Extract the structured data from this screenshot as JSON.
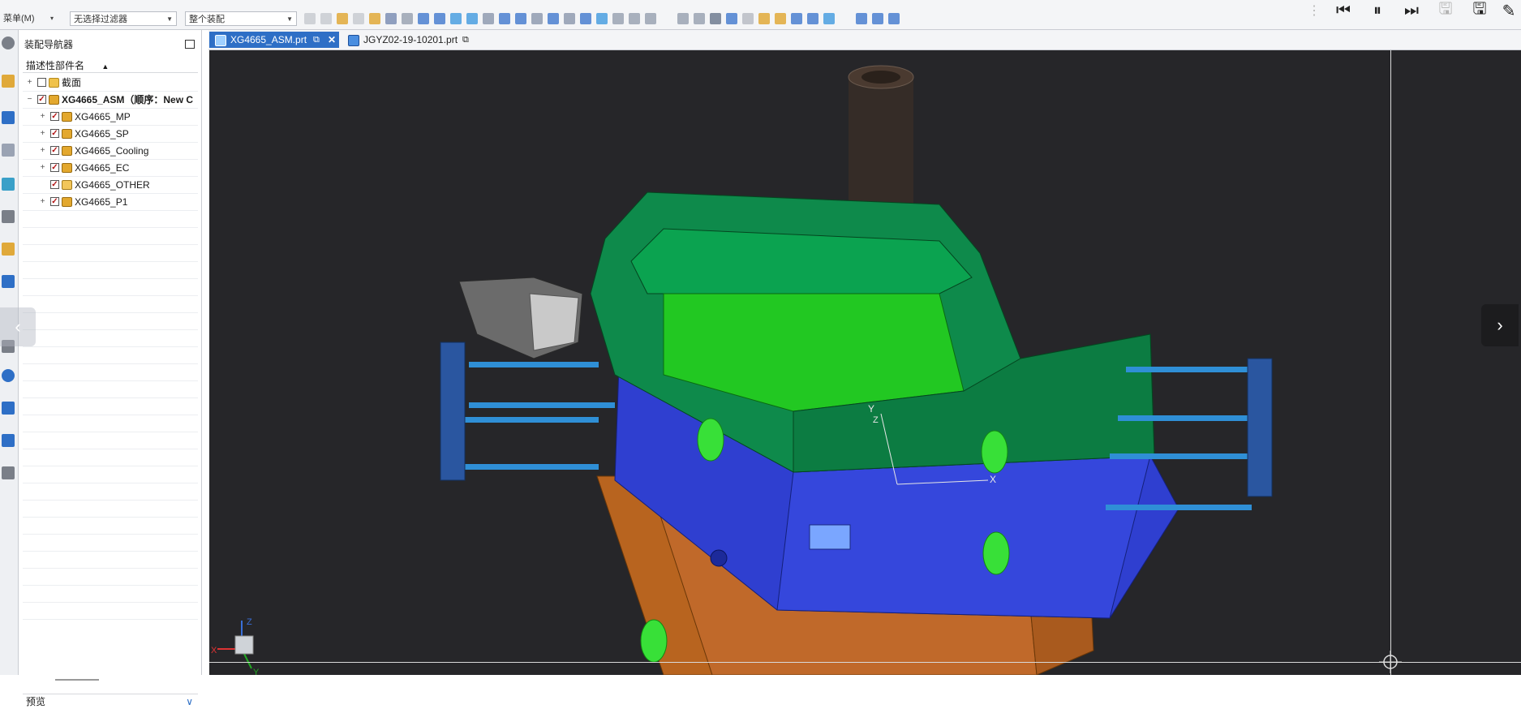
{
  "toolbar": {
    "menu_label": "菜单(M)",
    "filter_value": "无选择过滤器",
    "scope_value": "整个装配"
  },
  "media": {
    "controls": [
      "menu-icon",
      "skip-back-icon",
      "pause-icon",
      "skip-forward-icon",
      "save-icon",
      "save-as-icon",
      "edit-icon"
    ]
  },
  "navigator": {
    "title": "装配导航器",
    "column_header": "描述性部件名",
    "tree": [
      {
        "label": "截面",
        "checked": false,
        "expander": "+",
        "icon": "folder"
      },
      {
        "label": "XG4665_ASM（顺序：New C",
        "checked": true,
        "expander": "−",
        "icon": "assembly",
        "bold": true
      },
      {
        "label": "XG4665_MP",
        "checked": true,
        "expander": "+",
        "icon": "assembly"
      },
      {
        "label": "XG4665_SP",
        "checked": true,
        "expander": "+",
        "icon": "assembly"
      },
      {
        "label": "XG4665_Cooling",
        "checked": true,
        "expander": "+",
        "icon": "assembly"
      },
      {
        "label": "XG4665_EC",
        "checked": true,
        "expander": "+",
        "icon": "assembly"
      },
      {
        "label": "XG4665_OTHER",
        "checked": true,
        "expander": "",
        "icon": "part"
      },
      {
        "label": "XG4665_P1",
        "checked": true,
        "expander": "+",
        "icon": "assembly"
      }
    ],
    "preview_label": "预览"
  },
  "tabs": [
    {
      "label": "XG4665_ASM.prt",
      "active": true
    },
    {
      "label": "JGYZ02-19-10201.prt",
      "active": false
    }
  ],
  "viewport": {
    "axes": {
      "x": "X",
      "y": "Y",
      "z": "Z"
    },
    "triad_axes": {
      "x": "X",
      "y": "Y",
      "z": "Z"
    }
  }
}
